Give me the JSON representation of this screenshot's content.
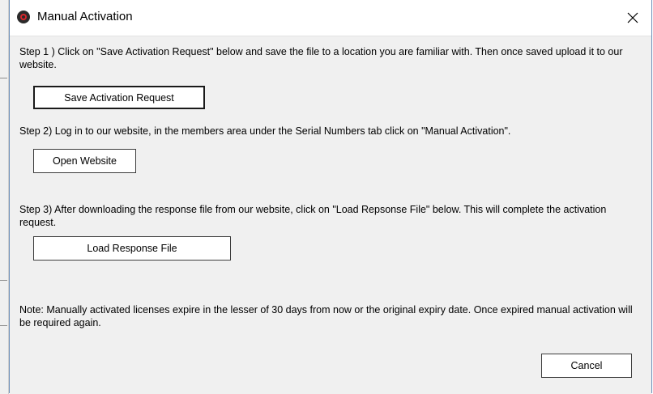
{
  "window": {
    "title": "Manual Activation",
    "icon": "app-logo-icon",
    "close_icon": "close-icon"
  },
  "step1": {
    "text": "Step 1 ) Click on \"Save Activation Request\" below and save the file to a location you are familiar with. Then once saved upload it to our website.",
    "button_label": "Save Activation Request"
  },
  "step2": {
    "text": "Step 2) Log in to our website, in the members area under the Serial Numbers tab click on \"Manual Activation\".",
    "button_label": "Open Website"
  },
  "step3": {
    "text": "Step 3) After downloading the response file from our website, click on \"Load Repsonse File\" below. This will complete the activation request.",
    "button_label": "Load Response File"
  },
  "note": {
    "text": "Note: Manually activated licenses expire in the lesser of 30 days from now or the original expiry date. Once expired manual activation will be required again."
  },
  "footer": {
    "cancel_label": "Cancel"
  },
  "colors": {
    "dialog_bg": "#f0f0f0",
    "titlebar_bg": "#ffffff",
    "window_border": "#6d8fb8",
    "icon_red": "#d8262c"
  }
}
